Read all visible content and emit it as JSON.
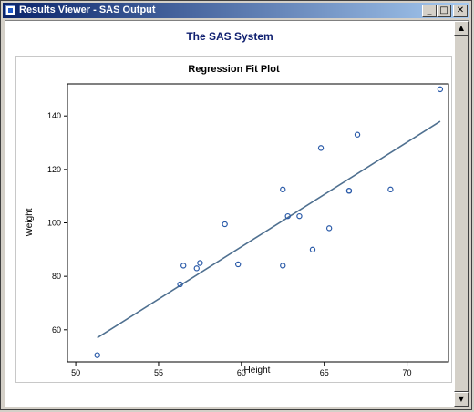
{
  "window": {
    "title": "Results Viewer - SAS Output",
    "min_icon": "minimize-icon",
    "max_icon": "maximize-icon",
    "close_icon": "close-icon"
  },
  "procedure_title": "The SAS System",
  "chart_data": {
    "type": "scatter",
    "title": "Regression Fit Plot",
    "xlabel": "Height",
    "ylabel": "Weight",
    "xlim": [
      49.5,
      72.5
    ],
    "ylim": [
      48,
      152
    ],
    "xticks": [
      50,
      55,
      60,
      65,
      70
    ],
    "yticks": [
      60,
      80,
      100,
      120,
      140
    ],
    "points": [
      {
        "x": 51.3,
        "y": 50.5
      },
      {
        "x": 56.3,
        "y": 77.0
      },
      {
        "x": 56.5,
        "y": 84.0
      },
      {
        "x": 57.3,
        "y": 83.0
      },
      {
        "x": 57.5,
        "y": 85.0
      },
      {
        "x": 59.0,
        "y": 99.5
      },
      {
        "x": 59.8,
        "y": 84.5
      },
      {
        "x": 62.5,
        "y": 112.5
      },
      {
        "x": 62.5,
        "y": 84.0
      },
      {
        "x": 62.8,
        "y": 102.5
      },
      {
        "x": 63.5,
        "y": 102.5
      },
      {
        "x": 64.3,
        "y": 90.0
      },
      {
        "x": 64.8,
        "y": 128.0
      },
      {
        "x": 65.3,
        "y": 98.0
      },
      {
        "x": 66.5,
        "y": 112.0
      },
      {
        "x": 66.5,
        "y": 112.0
      },
      {
        "x": 67.0,
        "y": 133.0
      },
      {
        "x": 69.0,
        "y": 112.5
      },
      {
        "x": 72.0,
        "y": 150.0
      }
    ],
    "fit_line": [
      {
        "x": 51.3,
        "y": 57.0
      },
      {
        "x": 72.0,
        "y": 138.0
      }
    ],
    "colors": {
      "marker": "#2a5aa8",
      "fit": "#4f7090"
    }
  }
}
